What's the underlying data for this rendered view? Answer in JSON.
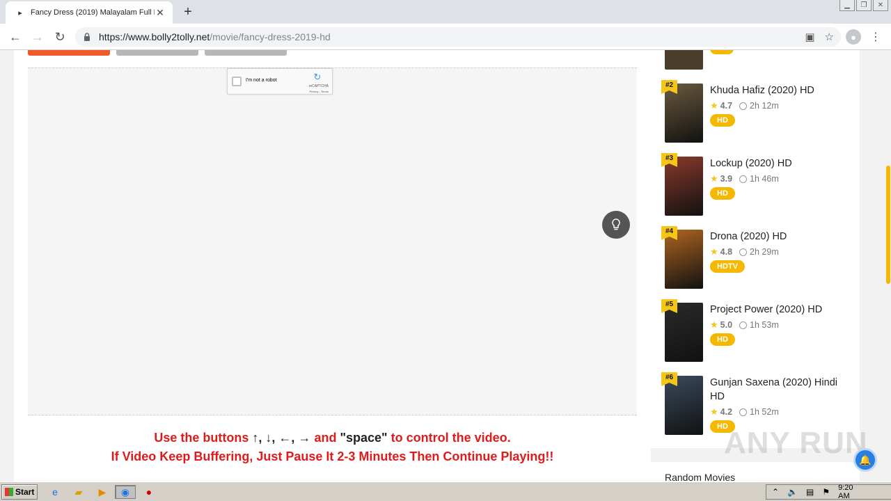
{
  "browser": {
    "tab_title": "Fancy Dress (2019) Malayalam Full M",
    "url_host": "https://www.bolly2tolly.net",
    "url_path": "/movie/fancy-dress-2019-hd"
  },
  "recaptcha": {
    "label": "I'm not a robot",
    "brand": "reCAPTCHA",
    "terms": "Privacy - Terms"
  },
  "notice": {
    "line1_prefix": "Use the buttons",
    "line1_keys": "↑, ↓, ←, →",
    "line1_and": "and",
    "line1_space": "\"space\"",
    "line1_suffix": "to control the video.",
    "line2": "If Video Keep Buffering, Just Pause It 2-3 Minutes Then Continue Playing!!"
  },
  "sidebar": {
    "items": [
      {
        "rank": "#2",
        "title": "Khuda Hafiz (2020) HD",
        "rating": "4.7",
        "duration": "2h 12m",
        "quality": "HD",
        "poster_color": "#6b5a3e"
      },
      {
        "rank": "#3",
        "title": "Lockup (2020) HD",
        "rating": "3.9",
        "duration": "1h 46m",
        "quality": "HD",
        "poster_color": "#8a3a2a"
      },
      {
        "rank": "#4",
        "title": "Drona (2020) HD",
        "rating": "4.8",
        "duration": "2h 29m",
        "quality": "HDTV",
        "poster_color": "#b0651f"
      },
      {
        "rank": "#5",
        "title": "Project Power (2020) HD",
        "rating": "5.0",
        "duration": "1h 53m",
        "quality": "HD",
        "poster_color": "#2a2a2a"
      },
      {
        "rank": "#6",
        "title": "Gunjan Saxena (2020) Hindi HD",
        "rating": "4.2",
        "duration": "1h 52m",
        "quality": "HD",
        "poster_color": "#3b4a5c"
      }
    ],
    "random_title": "Random Movies"
  },
  "watermark": "ANY RUN",
  "taskbar": {
    "start_label": "Start",
    "time": "9:20 AM"
  },
  "colors": {
    "accent": "#f5b800",
    "notice_red": "#e01b1b",
    "orange_button": "#f05a28",
    "grey_button": "#b7b7b7"
  }
}
